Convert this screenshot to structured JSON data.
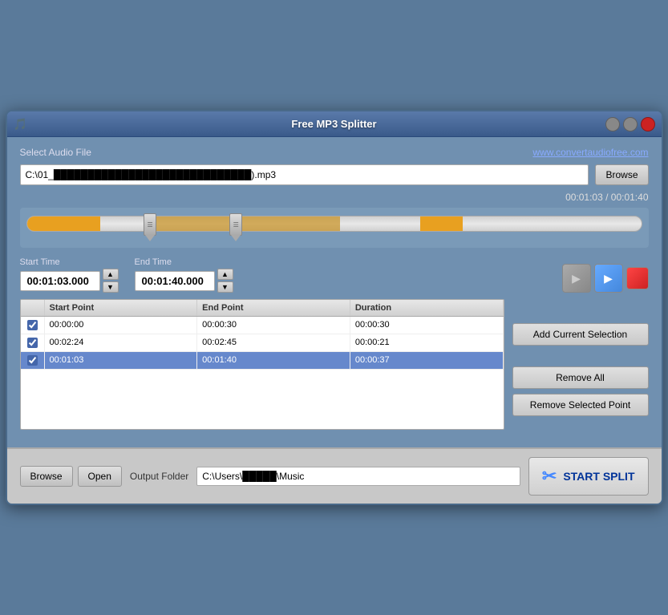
{
  "window": {
    "title": "Free MP3 Splitter"
  },
  "header": {
    "select_label": "Select Audio File",
    "website_link": "www.convertaudiofree.com",
    "file_path": "C:\\01_█████████████████████████████).mp3"
  },
  "player": {
    "current_time": "00:01:03",
    "total_time": "00:01:40",
    "time_display": "00:01:03 / 00:01:40"
  },
  "start_time": {
    "label": "Start Time",
    "value": "00:01:03.000"
  },
  "end_time": {
    "label": "End Time",
    "value": "00:01:40.000"
  },
  "table": {
    "columns": [
      "",
      "Start Point",
      "End Point",
      "Duration"
    ],
    "rows": [
      {
        "checked": true,
        "start": "00:00:00",
        "end": "00:00:30",
        "duration": "00:00:30",
        "selected": false
      },
      {
        "checked": true,
        "start": "00:02:24",
        "end": "00:02:45",
        "duration": "00:00:21",
        "selected": false
      },
      {
        "checked": true,
        "start": "00:01:03",
        "end": "00:01:40",
        "duration": "00:00:37",
        "selected": true
      }
    ]
  },
  "buttons": {
    "browse": "Browse",
    "add_selection": "Add Current Selection",
    "remove_all": "Remove All",
    "remove_selected": "Remove Selected Point",
    "browse_output": "Browse",
    "open": "Open",
    "start_split": "START SPLIT"
  },
  "output": {
    "label": "Output Folder",
    "path": "C:\\Users\\█████\\Music"
  }
}
